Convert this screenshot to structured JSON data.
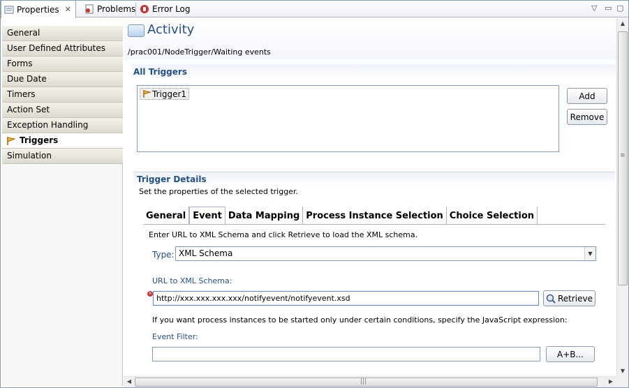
{
  "tabs": [
    {
      "label": "Properties",
      "icon": "properties-icon",
      "active": true
    },
    {
      "label": "Problems",
      "icon": "problems-icon",
      "active": false
    },
    {
      "label": "Error Log",
      "icon": "error-log-icon",
      "active": false
    }
  ],
  "categories": [
    {
      "label": "General"
    },
    {
      "label": "User Defined Attributes"
    },
    {
      "label": "Forms"
    },
    {
      "label": "Due Date"
    },
    {
      "label": "Timers"
    },
    {
      "label": "Action Set"
    },
    {
      "label": "Exception Handling"
    },
    {
      "label": "Triggers",
      "selected": true
    },
    {
      "label": "Simulation"
    }
  ],
  "header": {
    "title": "Activity",
    "path": "/prac001/NodeTrigger/Waiting events"
  },
  "all_triggers": {
    "title": "All Triggers",
    "items": [
      "Trigger1"
    ],
    "add_label": "Add",
    "remove_label": "Remove"
  },
  "trigger_details": {
    "title": "Trigger Details",
    "description": "Set the properties of the selected trigger.",
    "tabs": [
      "General",
      "Event",
      "Data Mapping",
      "Process Instance Selection",
      "Choice Selection"
    ],
    "active_tab": "Event",
    "event": {
      "instruction": "Enter URL to XML Schema and click Retrieve to load the XML schema.",
      "type_label": "Type:",
      "type_value": "XML Schema",
      "url_label": "URL to XML Schema:",
      "url_value": "http://xxx.xxx.xxx.xxx/notifyevent/notifyevent.xsd",
      "retrieve_label": "Retrieve",
      "condition_text": "If you want process instances to be started only under certain conditions, specify the JavaScript expression:",
      "filter_label": "Event Filter:",
      "filter_value": "",
      "expr_button_label": "A+B..."
    }
  },
  "colors": {
    "title_blue": "#24508a",
    "selection_border": "#5a8bd8",
    "error_red": "#d23030"
  }
}
